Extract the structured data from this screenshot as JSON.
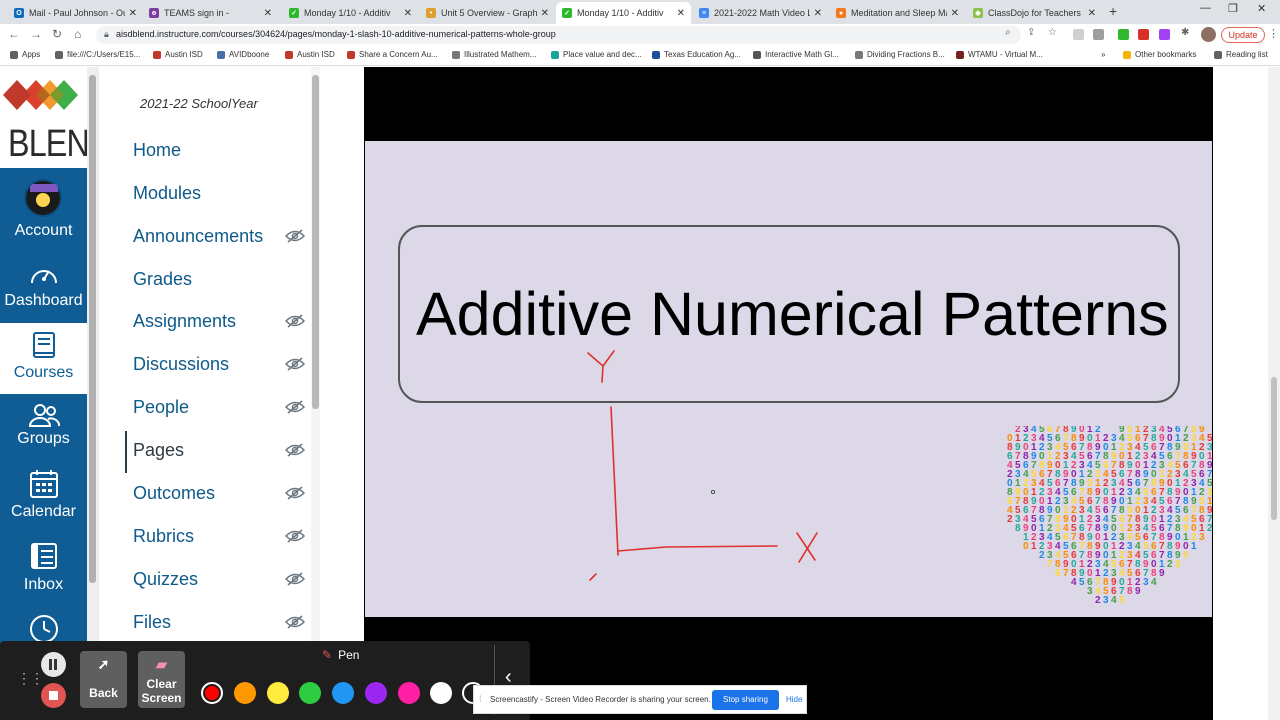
{
  "browser": {
    "tabs": [
      {
        "title": "Mail - Paul Johnson - Outl",
        "icon_color": "#0f6cbd",
        "icon_glyph": "O"
      },
      {
        "title": "TEAMS sign in -",
        "icon_color": "#7b3fa0",
        "icon_glyph": "ɵ"
      },
      {
        "title": "Monday 1/10 - Additiv",
        "icon_color": "#2eb82e",
        "icon_glyph": "✓"
      },
      {
        "title": "Unit 5 Overview - Graphi",
        "icon_color": "#e0a030",
        "icon_glyph": "•"
      },
      {
        "title": "Monday 1/10 - Additiv",
        "icon_color": "#2eb82e",
        "icon_glyph": "✓"
      },
      {
        "title": "2021-2022 Math Video Lin",
        "icon_color": "#4285f4",
        "icon_glyph": "≡"
      },
      {
        "title": "Meditation and Sleep Mad",
        "icon_color": "#f27a1a",
        "icon_glyph": "●"
      },
      {
        "title": "ClassDojo for Teachers",
        "icon_color": "#8bc34a",
        "icon_glyph": "◆"
      }
    ],
    "active_tab_index": 4,
    "url": "aisdblend.instructure.com/courses/304624/pages/monday-1-slash-10-additive-numerical-patterns-whole-group",
    "update_label": "Update",
    "bookmarks": [
      {
        "label": "Apps",
        "color": "#5f6368"
      },
      {
        "label": "file:///C:/Users/E15...",
        "color": "#5f6368"
      },
      {
        "label": "Austin ISD",
        "color": "#c0392b"
      },
      {
        "label": "AVIDboone",
        "color": "#4a6fa5"
      },
      {
        "label": "Austin ISD",
        "color": "#c0392b"
      },
      {
        "label": "Share a Concern Au...",
        "color": "#c0392b"
      },
      {
        "label": "Illustrated Mathem...",
        "color": "#777777"
      },
      {
        "label": "Place value and dec...",
        "color": "#1aa39a"
      },
      {
        "label": "Texas Education Ag...",
        "color": "#1f4e9c"
      },
      {
        "label": "Interactive Math Gl...",
        "color": "#555555"
      },
      {
        "label": "Dividing Fractions B...",
        "color": "#777777"
      },
      {
        "label": "WTAMU - Virtual M...",
        "color": "#7a1f1f"
      },
      {
        "label": "Other bookmarks",
        "color": "#f4b400"
      },
      {
        "label": "Reading list",
        "color": "#5f6368"
      }
    ]
  },
  "global_nav": {
    "logo_text": "BLEND",
    "items": [
      {
        "label": "Account",
        "icon": "account-avatar-icon"
      },
      {
        "label": "Dashboard",
        "icon": "dashboard-icon"
      },
      {
        "label": "Courses",
        "icon": "courses-icon"
      },
      {
        "label": "Groups",
        "icon": "groups-icon"
      },
      {
        "label": "Calendar",
        "icon": "calendar-icon"
      },
      {
        "label": "Inbox",
        "icon": "inbox-icon"
      },
      {
        "label": "",
        "icon": "history-icon"
      }
    ],
    "active_item": "Courses",
    "colors": {
      "nav_bg": "#0f5d94",
      "link": "#0e5a8a"
    }
  },
  "course_nav": {
    "term": "2021-22 SchoolYear",
    "items": [
      {
        "label": "Home",
        "hidden_eye": false
      },
      {
        "label": "Modules",
        "hidden_eye": false
      },
      {
        "label": "Announcements",
        "hidden_eye": true
      },
      {
        "label": "Grades",
        "hidden_eye": false
      },
      {
        "label": "Assignments",
        "hidden_eye": true
      },
      {
        "label": "Discussions",
        "hidden_eye": true
      },
      {
        "label": "People",
        "hidden_eye": true
      },
      {
        "label": "Pages",
        "hidden_eye": true
      },
      {
        "label": "Outcomes",
        "hidden_eye": true
      },
      {
        "label": "Rubrics",
        "hidden_eye": true
      },
      {
        "label": "Quizzes",
        "hidden_eye": true
      },
      {
        "label": "Files",
        "hidden_eye": true
      }
    ],
    "active_item": "Pages"
  },
  "slide": {
    "title": "Additive Numerical Patterns",
    "axis_y_label": "Y",
    "axis_x_label": "X",
    "background": "#dcd8e8",
    "annotation_color": "#e0302a"
  },
  "screencastify": {
    "back_label": "Back",
    "clear_label_line1": "Clear",
    "clear_label_line2": "Screen",
    "tool_label": "Pen",
    "colors": [
      "#ff0000",
      "#ff9800",
      "#ffeb3b",
      "#2ecc40",
      "#2196f3",
      "#9c27f0",
      "#ff1fa5",
      "#ffffff",
      "#1e1e1e"
    ],
    "selected_color_index": 0
  },
  "share_notice": {
    "message": "Screencastify - Screen Video Recorder is sharing your screen.",
    "stop_label": "Stop sharing",
    "hide_label": "Hide"
  }
}
